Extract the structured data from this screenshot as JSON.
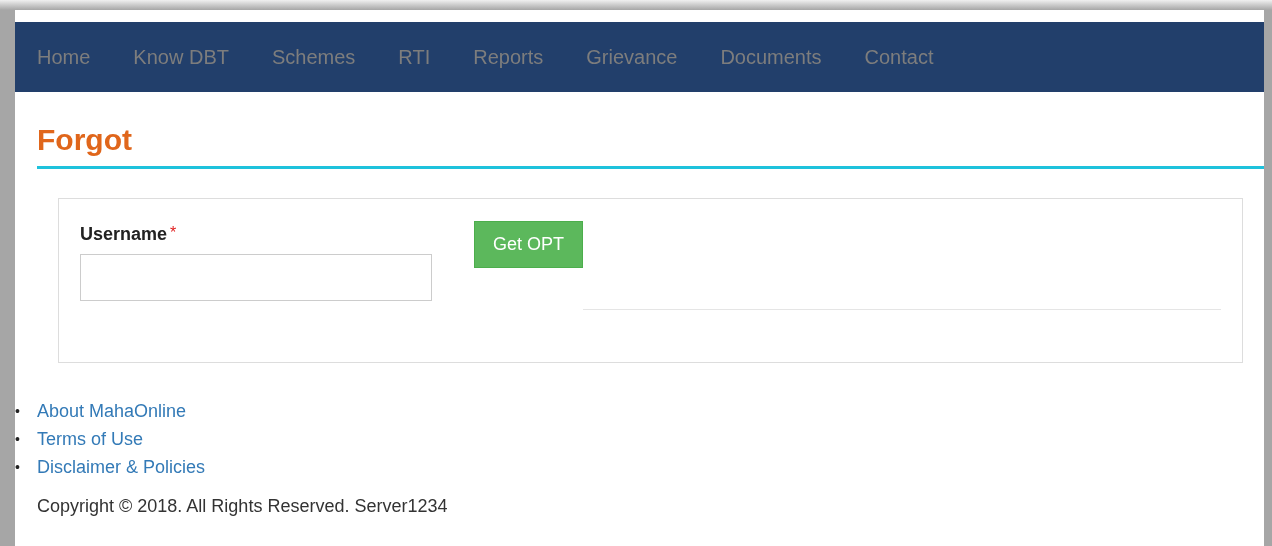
{
  "nav": [
    {
      "label": "Home"
    },
    {
      "label": "Know DBT"
    },
    {
      "label": "Schemes"
    },
    {
      "label": "RTI"
    },
    {
      "label": "Reports"
    },
    {
      "label": "Grievance"
    },
    {
      "label": "Documents"
    },
    {
      "label": "Contact"
    }
  ],
  "page_title": "Forgot",
  "form": {
    "label": "Username",
    "required_mark": "*",
    "button": "Get OPT"
  },
  "footer_links": [
    {
      "bullet": "•",
      "label": "About MahaOnline"
    },
    {
      "bullet": "•",
      "label": "Terms of Use"
    },
    {
      "bullet": "•",
      "label": "Disclaimer & Policies"
    }
  ],
  "copyright": "Copyright © 2018. All Rights Reserved. Server1234"
}
